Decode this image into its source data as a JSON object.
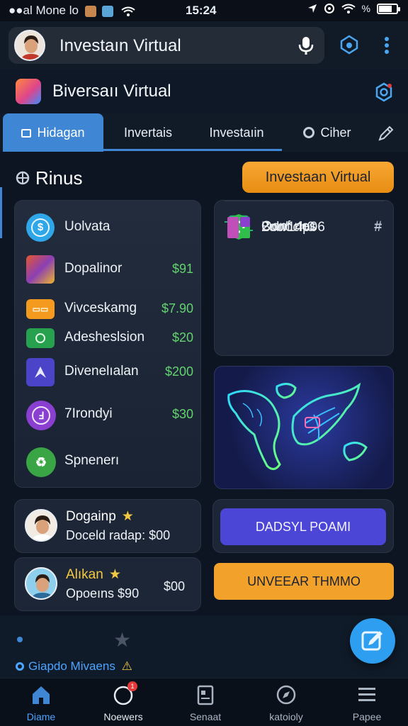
{
  "status_bar": {
    "carrier": "●●al Mone lo",
    "time": "15:24"
  },
  "top_bar": {
    "title": "Investaın Virtual"
  },
  "header": {
    "app_name": "Biversaıı Virtual"
  },
  "tabs": [
    {
      "label": "Hidagan",
      "active": true
    },
    {
      "label": "Invertais"
    },
    {
      "label": "Investaıin"
    },
    {
      "label": "Ciher"
    }
  ],
  "section": {
    "title": "Rinus",
    "cta_label": "Investaan Virtual"
  },
  "list": [
    {
      "label": "Uolvata",
      "amount": "",
      "icon": "dollar-circle-icon",
      "color": "#2fa6e8"
    },
    {
      "label": "Dopalinor",
      "amount": "$91",
      "icon": "food-thumbnail-icon",
      "color": "#8a3fb5"
    },
    {
      "label": "Vivceskamg",
      "amount": "$7.90",
      "icon": "coupon-icon",
      "color": "#f39a1f"
    },
    {
      "label": "Adesheslsion",
      "amount": "$20",
      "icon": "cash-icon",
      "color": "#27a14e"
    },
    {
      "label": "Divenelıalan",
      "amount": "$200",
      "icon": "send-arrow-icon",
      "color": "#4b44c9"
    },
    {
      "label": "7Irondyi",
      "amount": "$30",
      "icon": "coin-icon",
      "color": "#8a3fd1"
    },
    {
      "label": "Spnenerı",
      "amount": "",
      "icon": "recycle-icon",
      "color": "#3aa545"
    }
  ],
  "right_list": [
    {
      "label": "Oonf nes",
      "hash": "#",
      "icon": "chip-icon",
      "color": "#21b07a"
    },
    {
      "label": "Bonoch0",
      "hash": "#",
      "icon": "shield-icon",
      "color": "#2fbf4a"
    },
    {
      "label": "2ob/14p06",
      "hash": "#",
      "icon": "gift-icon",
      "color": "#c04fb9"
    }
  ],
  "profiles": [
    {
      "name": "Dogainp",
      "sub": "Doceld radap: $00",
      "amount": ""
    },
    {
      "name": "Alıkan",
      "sub": "Opoeıns $90",
      "amount": "$00"
    }
  ],
  "buttons": [
    {
      "label": "DADSYL POAMI",
      "color": "#4b46d6",
      "text_color": "#f3f3ff"
    },
    {
      "label": "UNVEEAR THMMO",
      "color": "#f2a12a",
      "text_color": "#1b2232"
    }
  ],
  "bottom_strip": {
    "info": "Giapdo Mivaens"
  },
  "nav": [
    {
      "label": "Diame",
      "icon": "home-icon",
      "active": true
    },
    {
      "label": "Noewers",
      "icon": "notifications-icon",
      "badge": "1"
    },
    {
      "label": "Senaat",
      "icon": "document-icon"
    },
    {
      "label": "katoioly",
      "icon": "compass-icon"
    },
    {
      "label": "Papee",
      "icon": "menu-icon"
    }
  ],
  "colors": {
    "accent": "#3f86d4",
    "background": "#0d1522",
    "orange": "#f2a12a",
    "green_amount": "#63d36f"
  }
}
